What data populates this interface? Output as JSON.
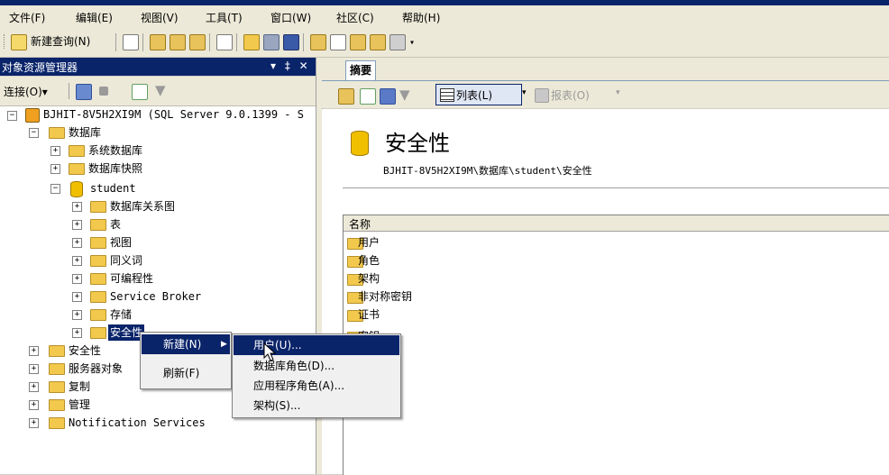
{
  "menubar": {
    "items": [
      "文件(F)",
      "编辑(E)",
      "视图(V)",
      "工具(T)",
      "窗口(W)",
      "社区(C)",
      "帮助(H)"
    ]
  },
  "toolbar": {
    "new_query_label": "新建查询(N)"
  },
  "object_explorer": {
    "title": "对象资源管理器",
    "pin_glyphs": "▾ ‡ ✕",
    "connect_label": "连接(O)▾",
    "tree": {
      "server": "BJHIT-8V5H2XI9M (SQL Server 9.0.1399 - S",
      "databases": "数据库",
      "system_databases": "系统数据库",
      "db_snapshots": "数据库快照",
      "student": "student",
      "student_children": [
        "数据库关系图",
        "表",
        "视图",
        "同义词",
        "可编程性",
        "Service Broker",
        "存储",
        "安全性"
      ],
      "security": "安全性",
      "server_objects": "服务器对象",
      "replication": "复制",
      "management": "管理",
      "notification": "Notification Services"
    }
  },
  "summary": {
    "tab_label": "摘要",
    "list_button": "列表(L)",
    "report_button": "报表(O)",
    "title": "安全性",
    "path": "BJHIT-8V5H2XI9M\\数据库\\student\\安全性",
    "column_name": "名称",
    "items": [
      "用户",
      "角色",
      "架构",
      "非对称密钥",
      "证书",
      "密钥"
    ]
  },
  "context_menu": {
    "items": [
      "新建(N)",
      "刷新(F)"
    ],
    "submenu": [
      "用户(U)...",
      "数据库角色(D)...",
      "应用程序角色(A)...",
      "架构(S)..."
    ]
  },
  "colors": {
    "titlebar": "#0a246a",
    "highlight": "#0a246a",
    "folder": "#f2c94c"
  }
}
